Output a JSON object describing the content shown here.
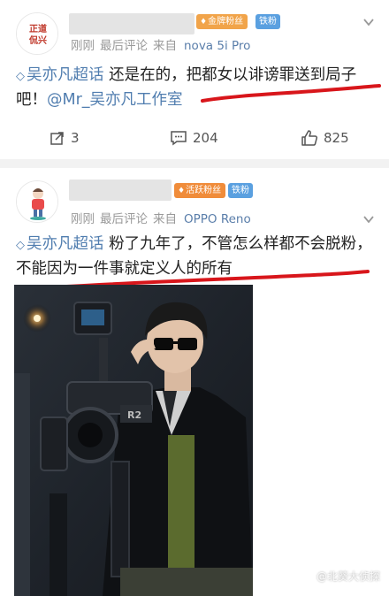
{
  "post1": {
    "avatar_text": "正道侃兴",
    "fan_badge": "金牌粉丝",
    "fan_badge_color": "#f1a44a",
    "small_badge": "铁粉",
    "time": "刚刚",
    "recent": "最后评论",
    "from_label": "来自",
    "device": "nova 5i Pro",
    "topic": "吴亦凡超话",
    "text": "还是在的，把都女以诽谤罪送到局子吧！",
    "mention": "@Mr_吴亦凡工作室",
    "reposts": "3",
    "comments": "204",
    "likes": "825"
  },
  "post2": {
    "fan_badge": "活跃粉丝",
    "fan_badge_color": "#f08c3a",
    "small_badge": "铁粉",
    "time": "刚刚",
    "recent": "最后评论",
    "from_label": "来自",
    "device": "OPPO Reno",
    "topic": "吴亦凡超话",
    "text": "粉了九年了，不管怎么样都不会脱粉，不能因为一件事就定义人的所有"
  },
  "watermark": "@北葵大侦探",
  "colors": {
    "link": "#507daf",
    "meta": "#9a9a9a",
    "annotation": "#d8161b"
  },
  "icons": [
    "chevron-down-icon",
    "diamond-icon",
    "repost-icon",
    "comment-icon",
    "like-icon",
    "weibo-logo-icon"
  ]
}
